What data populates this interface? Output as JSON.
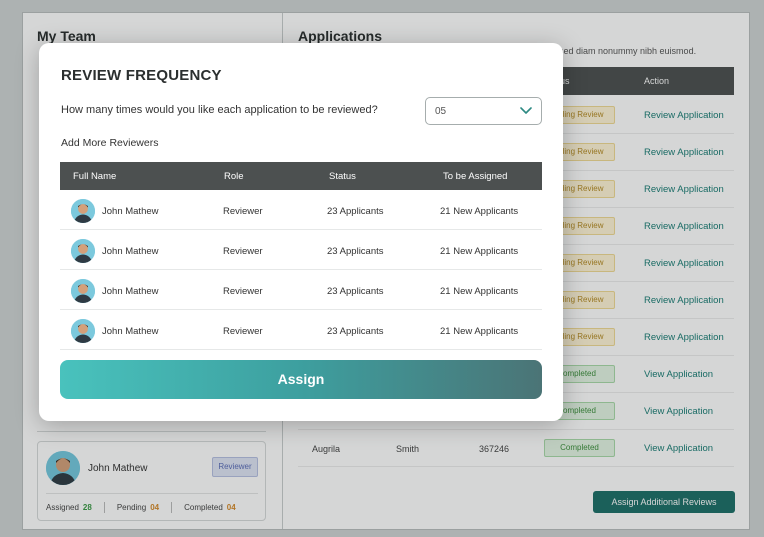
{
  "background": {
    "team_panel": {
      "title": "My Team",
      "card": {
        "name": "John Mathew",
        "role": "Reviewer",
        "assigned_label": "Assigned",
        "assigned_value": "28",
        "pending_label": "Pending",
        "pending_value": "04",
        "completed_label": "Completed",
        "completed_value": "04"
      }
    },
    "applications_panel": {
      "title": "Applications",
      "description": "sed diam nonummy nibh euismod.",
      "columns": {
        "status": "us",
        "action": "Action"
      },
      "rows": [
        {
          "status": "nding Review",
          "status_type": "pending",
          "action": "Review Application"
        },
        {
          "status": "nding Review",
          "status_type": "pending",
          "action": "Review Application"
        },
        {
          "status": "nding Review",
          "status_type": "pending",
          "action": "Review Application"
        },
        {
          "status": "nding Review",
          "status_type": "pending",
          "action": "Review Application"
        },
        {
          "status": "nding Review",
          "status_type": "pending",
          "action": "Review Application"
        },
        {
          "status": "nding Review",
          "status_type": "pending",
          "action": "Review Application"
        },
        {
          "status": "nding Review",
          "status_type": "pending",
          "action": "Review Application"
        },
        {
          "status": "ompleted",
          "status_type": "completed",
          "action": "View Application"
        },
        {
          "status": "ompleted",
          "status_type": "completed",
          "action": "View Application"
        },
        {
          "first_name": "Augrila",
          "last_name": "Smith",
          "id": "367246",
          "status": "Completed",
          "status_type": "completed",
          "action": "View Application"
        }
      ],
      "assign_additional_label": "Assign Additional Reviews"
    }
  },
  "modal": {
    "title": "REVIEW FREQUENCY",
    "question": "How many times would you like each application to be reviewed?",
    "frequency_value": "05",
    "add_more_label": "Add More Reviewers",
    "columns": {
      "full_name": "Full Name",
      "role": "Role",
      "status": "Status",
      "to_be_assigned": "To be Assigned"
    },
    "reviewers": [
      {
        "name": "John Mathew",
        "role": "Reviewer",
        "status": "23 Applicants",
        "to_be_assigned": "21 New Applicants"
      },
      {
        "name": "John Mathew",
        "role": "Reviewer",
        "status": "23 Applicants",
        "to_be_assigned": "21 New Applicants"
      },
      {
        "name": "John Mathew",
        "role": "Reviewer",
        "status": "23 Applicants",
        "to_be_assigned": "21 New Applicants"
      },
      {
        "name": "John Mathew",
        "role": "Reviewer",
        "status": "23 Applicants",
        "to_be_assigned": "21 New Applicants"
      }
    ],
    "assign_label": "Assign"
  },
  "colors": {
    "accent": "#1d6f68",
    "table_header": "#4c5050",
    "link": "#1a7d75"
  },
  "icons": {
    "select_chevron": "chevron-down-icon",
    "avatar": "user-avatar-icon"
  }
}
